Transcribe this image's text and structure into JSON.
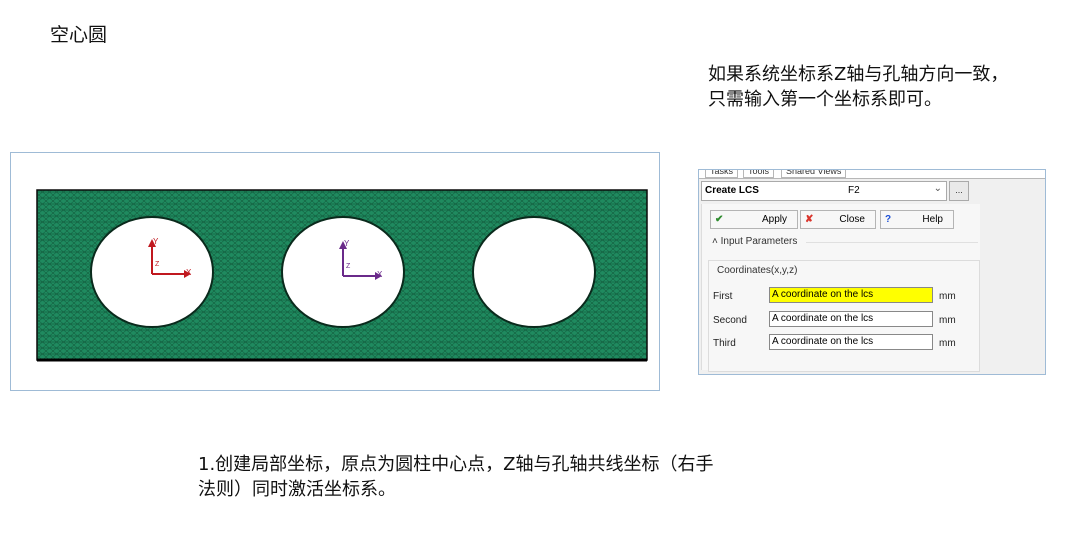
{
  "page": {
    "title": "空心圆",
    "note_line1": "如果系统坐标系Z轴与孔轴方向一致，",
    "note_line2": "只需输入第一个坐标系即可。",
    "bottom_line1": "1.创建局部坐标，原点为圆柱中心点，Z轴与孔轴共线坐标（右手",
    "bottom_line2": "法则）同时激活坐标系。"
  },
  "mesh_view": {
    "plate_color": "#1f8a5f",
    "axis_labels": {
      "x": "X",
      "y": "Y",
      "z": "Z"
    },
    "hole_count": 3
  },
  "panel": {
    "tabs": [
      "Tasks",
      "Tools",
      "Shared Views"
    ],
    "tool_name": "Create LCS",
    "tool_key": "F2",
    "more_button": "...",
    "buttons": {
      "apply": "Apply",
      "close": "Close",
      "help": "Help"
    },
    "section": "Input Parameters",
    "group_title": "Coordinates(x,y,z)",
    "rows": [
      {
        "label": "First",
        "value": "A coordinate on the lcs",
        "unit": "mm"
      },
      {
        "label": "Second",
        "value": "A coordinate on the lcs",
        "unit": "mm"
      },
      {
        "label": "Third",
        "value": "A coordinate on the lcs",
        "unit": "mm"
      }
    ],
    "colors": {
      "active_field": "#ffff00",
      "apply_check": "#2e8b2e",
      "close_x": "#d9342b",
      "help_q": "#1c4fd6"
    }
  }
}
